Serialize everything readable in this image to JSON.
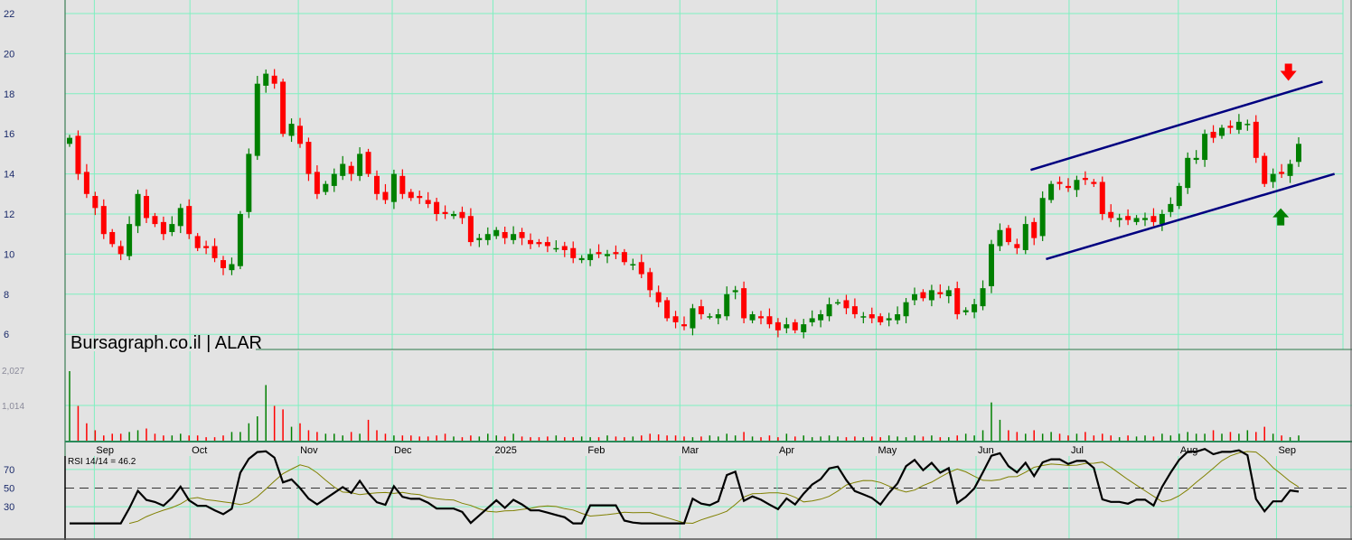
{
  "chart_data": {
    "type": "candlestick",
    "title": "Bursagraph.co.il | ALAR",
    "symbol": "ALAR",
    "price_axis": {
      "ticks": [
        22,
        20,
        18,
        16,
        14,
        12,
        10,
        8,
        6
      ],
      "ylim": [
        6,
        22
      ]
    },
    "volume_axis": {
      "ticks": [
        {
          "value": 2027,
          "label": "2,027"
        },
        {
          "value": 1014,
          "label": "1,014"
        }
      ],
      "ylim": [
        0,
        2280
      ]
    },
    "rsi_axis": {
      "ticks": [
        70,
        50,
        30
      ],
      "ylim": [
        0,
        100
      ],
      "reference_line": 50
    },
    "rsi_label": "RSI 14/14 = 46.2",
    "months": [
      {
        "label": "Sep",
        "grid": 2.9
      },
      {
        "label": "Oct",
        "grid": 14.1
      },
      {
        "label": "Nov",
        "grid": 26.8
      },
      {
        "label": "Dec",
        "grid": 37.8
      },
      {
        "label": "2025",
        "grid": 49.6
      },
      {
        "label": "Feb",
        "grid": 60.5
      },
      {
        "label": "Mar",
        "grid": 71.5
      },
      {
        "label": "Apr",
        "grid": 82.9
      },
      {
        "label": "May",
        "grid": 94.5
      },
      {
        "label": "Jun",
        "grid": 106.2
      },
      {
        "label": "Jul",
        "grid": 117.1
      },
      {
        "label": "Aug",
        "grid": 129.9
      },
      {
        "label": "Sep",
        "grid": 141.4
      }
    ],
    "close": [
      15.8,
      14,
      13,
      12.3,
      11,
      10.5,
      10,
      11.5,
      13,
      11.8,
      11.5,
      11,
      11.5,
      12.3,
      11,
      10.3,
      10.3,
      9.8,
      9.3,
      9.5,
      12,
      15,
      18.5,
      19,
      18.5,
      16,
      16.5,
      15.5,
      14,
      13,
      13.5,
      14,
      14.5,
      14,
      15,
      14,
      13,
      12.7,
      14,
      13,
      12.8,
      12.8,
      12.5,
      12,
      12,
      12,
      11.8,
      10.6,
      10.8,
      11,
      11.2,
      10.8,
      11,
      10.8,
      10.5,
      10.5,
      10.4,
      10.3,
      10.2,
      9.8,
      9.8,
      10,
      10,
      10,
      10,
      9.6,
      9.5,
      9,
      8.2,
      7.6,
      6.8,
      6.6,
      6.4,
      7.3,
      7,
      6.9,
      7,
      8,
      8.2,
      6.8,
      7,
      6.8,
      6.5,
      6.2,
      6.5,
      6.2,
      6.5,
      6.8,
      7,
      7.5,
      7.6,
      7.3,
      7,
      6.9,
      6.8,
      6.6,
      6.8,
      7,
      7.6,
      8,
      7.8,
      8.2,
      8,
      8.2,
      7,
      7.2,
      7.5,
      8.3,
      10.5,
      11.2,
      10.6,
      10.3,
      11.5,
      10.8,
      12.8,
      13.5,
      13.5,
      13.3,
      13.7,
      13.7,
      13.5,
      12,
      11.8,
      11.8,
      11.7,
      11.8,
      11.8,
      11.6,
      12,
      12.5,
      13.4,
      14.8,
      14.8,
      16,
      15.8,
      16.3,
      16.3,
      16.6,
      16.5,
      14.8,
      13.5,
      14,
      14,
      14.5,
      15.5
    ],
    "volume": [
      2000,
      1000,
      500,
      300,
      150,
      200,
      200,
      250,
      300,
      350,
      200,
      150,
      150,
      200,
      150,
      150,
      100,
      100,
      150,
      250,
      250,
      500,
      700,
      1600,
      1000,
      900,
      400,
      500,
      300,
      250,
      200,
      200,
      150,
      250,
      200,
      600,
      300,
      200,
      150,
      150,
      150,
      120,
      120,
      150,
      200,
      120,
      100,
      150,
      120,
      200,
      150,
      120,
      200,
      120,
      100,
      100,
      120,
      150,
      100,
      100,
      120,
      100,
      100,
      150,
      120,
      100,
      120,
      150,
      200,
      180,
      150,
      150,
      120,
      100,
      120,
      150,
      120,
      200,
      150,
      250,
      120,
      100,
      150,
      100,
      200,
      120,
      150,
      100,
      120,
      150,
      120,
      100,
      120,
      100,
      120,
      100,
      150,
      120,
      100,
      150,
      120,
      150,
      100,
      100,
      150,
      200,
      150,
      300,
      1100,
      600,
      300,
      250,
      200,
      300,
      200,
      250,
      200,
      150,
      200,
      250,
      150,
      200,
      150,
      100,
      150,
      120,
      150,
      120,
      200,
      150,
      200,
      250,
      200,
      200,
      300,
      200,
      250,
      200,
      300,
      250,
      400,
      200,
      150,
      100,
      150
    ],
    "channel": {
      "upper": [
        [
          112.6,
          14.2
        ],
        [
          146.8,
          18.6
        ]
      ],
      "lower": [
        [
          114.4,
          9.75
        ],
        [
          148.2,
          14.0
        ]
      ]
    },
    "arrows": [
      {
        "direction": "down",
        "index": 142.8,
        "price": 18.6
      },
      {
        "direction": "up",
        "index": 141.9,
        "price": 12.6
      }
    ],
    "colors": {
      "up": "#008000",
      "down": "#ff0000",
      "grid": "#7ff0c0",
      "channel": "#000080",
      "rsi": "#000000",
      "rsi_signal": "#808000"
    }
  }
}
